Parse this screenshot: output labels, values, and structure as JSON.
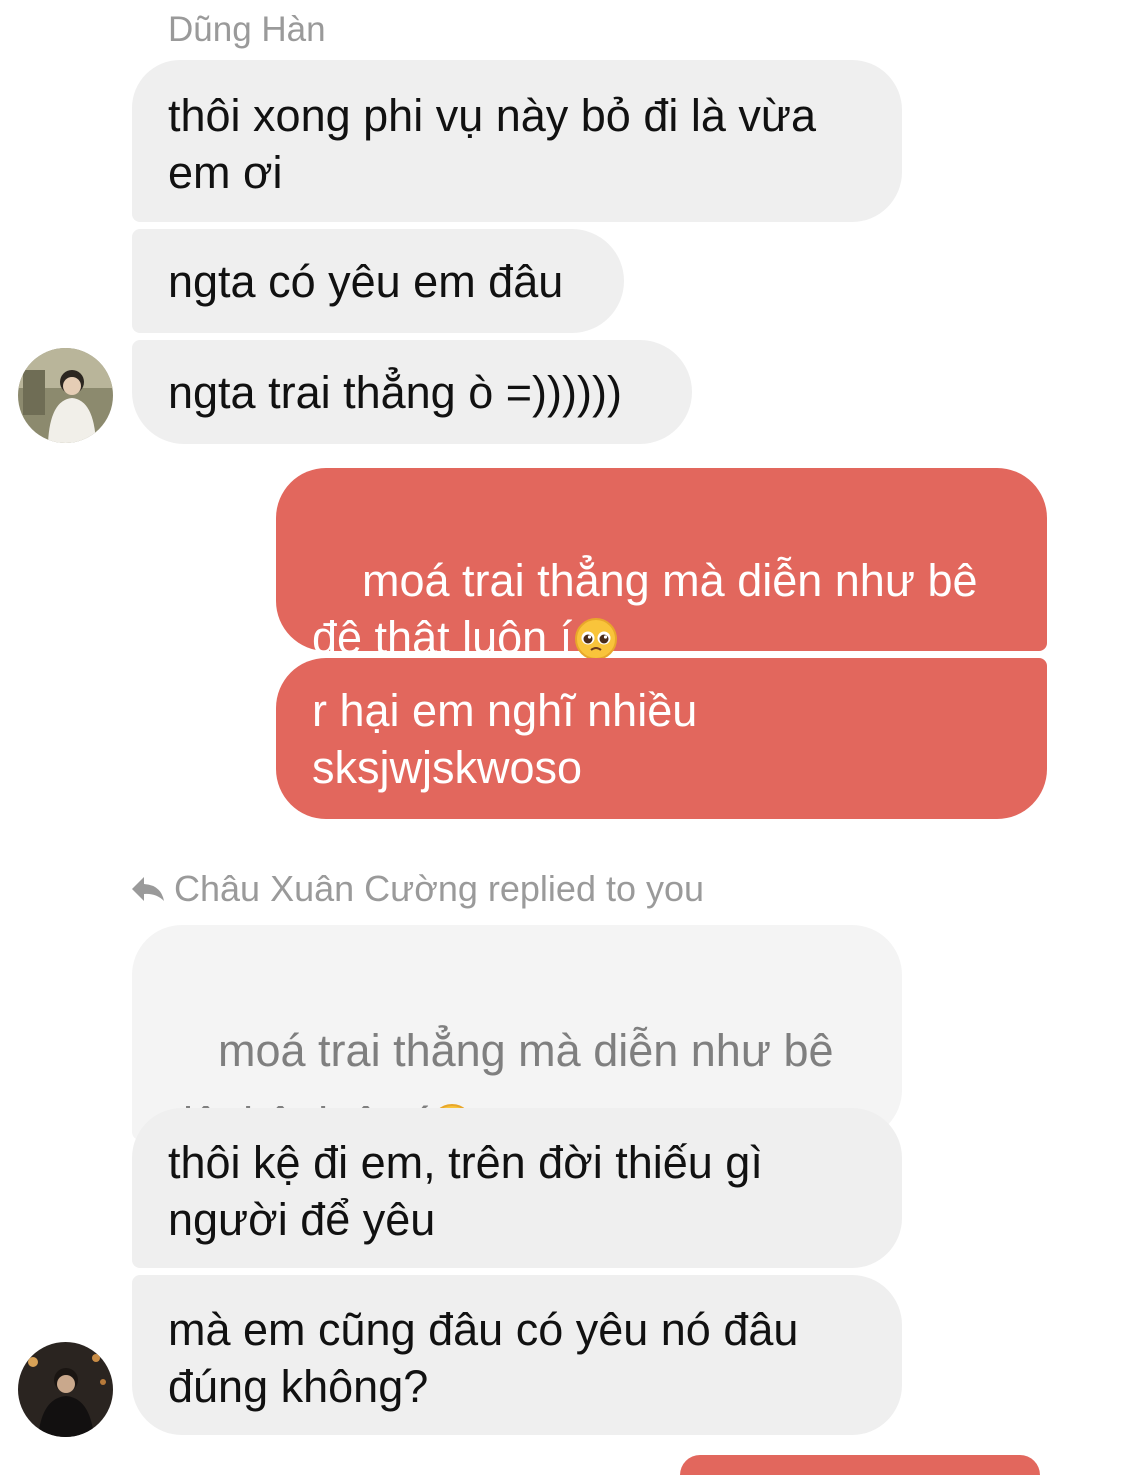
{
  "conversation": {
    "first_sender": {
      "name": "Dũng Hàn",
      "messages": [
        "thôi xong phi vụ này bỏ đi là vừa\nem ơi",
        "ngta có yêu em đâu",
        "ngta trai thẳng ò =))))))"
      ]
    },
    "outgoing": {
      "messages": [
        {
          "text": "moá trai thẳng mà diễn như bê\nđê thật luôn í",
          "emoji": "pleading-face"
        },
        {
          "text": "r hại em nghĩ nhiều\nsksjwjskwoso"
        }
      ]
    },
    "reply_header": "Châu Xuân Cường replied to you",
    "quoted_message": {
      "text": "moá trai thẳng mà diễn như bê\nđê thật luôn í",
      "emoji": "pleading-face"
    },
    "second_sender": {
      "messages": [
        "thôi kệ đi em, trên đời thiếu gì\nngười để yêu",
        "mà em cũng đâu có yêu nó đâu\nđúng không?"
      ]
    }
  },
  "colors": {
    "outgoing_bubble": "#e2675d",
    "incoming_bubble": "#efefef",
    "quoted_bubble": "#f4f4f4",
    "meta_text": "#9a9a9a"
  }
}
